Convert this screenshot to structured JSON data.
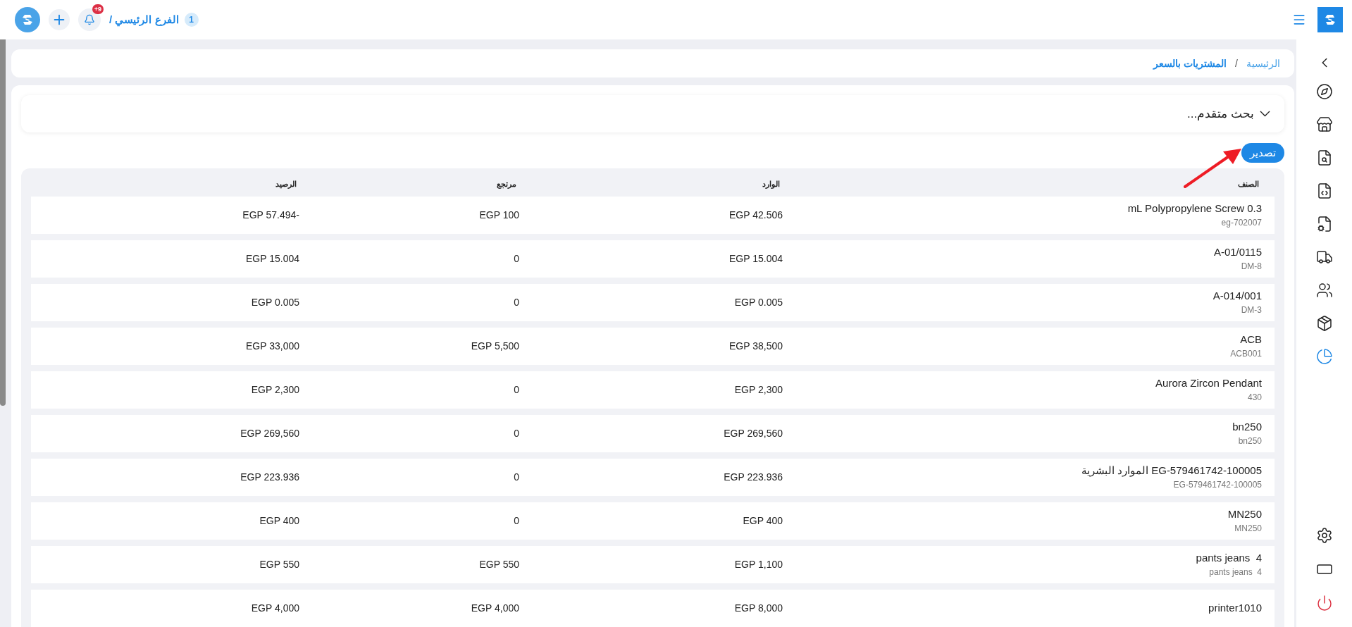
{
  "top_bar": {
    "branch_count": "1",
    "branch": "الفرع الرئيسي /",
    "notifications_badge": "+9"
  },
  "sidebar": {
    "items": [
      {
        "kind": "compass",
        "selected": false
      },
      {
        "kind": "store",
        "selected": false
      },
      {
        "kind": "file-search",
        "selected": false
      },
      {
        "kind": "file-code",
        "selected": false
      },
      {
        "kind": "file-refresh",
        "selected": false
      },
      {
        "kind": "truck",
        "selected": false
      },
      {
        "kind": "users",
        "selected": false
      },
      {
        "kind": "package",
        "selected": false
      },
      {
        "kind": "report",
        "selected": true
      }
    ],
    "bottom": [
      {
        "kind": "settings"
      },
      {
        "kind": "screen"
      },
      {
        "kind": "power"
      }
    ]
  },
  "breadcrumb": {
    "separator": "/",
    "items": [
      {
        "label": "الرئيسية",
        "current": false
      },
      {
        "label": "المشتريات بالسعر",
        "current": true
      }
    ]
  },
  "advanced_search": {
    "label": "بحث متقدم...",
    "expanded": false
  },
  "export_button": "تصدير",
  "table": {
    "columns": [
      "الصنف",
      "الوارد",
      "مرتجع",
      "الرصيد"
    ],
    "rows": [
      {
        "item": "mL Polypropylene Screw 0.3",
        "code": "eg-702007",
        "incoming": "EGP 42.506",
        "returned": "EGP 100",
        "balance": "EGP 57.494-"
      },
      {
        "item": "A-01/0115",
        "code": "DM-8",
        "incoming": "EGP 15.004",
        "returned": "0",
        "balance": "EGP 15.004"
      },
      {
        "item": "A-014/001",
        "code": "DM-3",
        "incoming": "EGP 0.005",
        "returned": "0",
        "balance": "EGP 0.005"
      },
      {
        "item": "ACB",
        "code": "ACB001",
        "incoming": "EGP 38,500",
        "returned": "EGP 5,500",
        "balance": "EGP 33,000"
      },
      {
        "item": "Aurora Zircon Pendant",
        "code": "430",
        "incoming": "EGP 2,300",
        "returned": "0",
        "balance": "EGP 2,300"
      },
      {
        "item": "bn250",
        "code": "bn250",
        "incoming": "EGP 269,560",
        "returned": "0",
        "balance": "EGP 269,560"
      },
      {
        "item": "EG-579461742-100005 الموارد البشرية",
        "code": "EG-579461742-100005",
        "incoming": "EGP 223.936",
        "returned": "0",
        "balance": "EGP 223.936"
      },
      {
        "item": "MN250",
        "code": "MN250",
        "incoming": "EGP 400",
        "returned": "0",
        "balance": "EGP 400"
      },
      {
        "item": "pants jeans  4",
        "code": "pants jeans  4",
        "incoming": "EGP 1,100",
        "returned": "EGP 550",
        "balance": "EGP 550"
      },
      {
        "item": "printer1010",
        "incoming": "EGP 8,000",
        "returned": "EGP 4,000",
        "balance": "EGP 4,000"
      }
    ]
  }
}
